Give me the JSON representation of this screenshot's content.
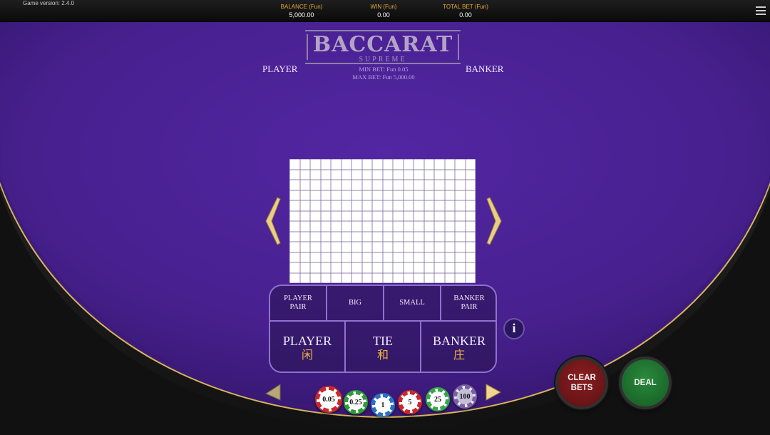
{
  "header": {
    "game_version": "Game version: 2.4.0",
    "balance_label": "BALANCE (Fun)",
    "balance_value": "5,000.00",
    "win_label": "WIN (Fun)",
    "win_value": "0.00",
    "total_bet_label": "TOTAL BET (Fun)",
    "total_bet_value": "0.00",
    "menu_icon": "hamburger-menu-icon"
  },
  "logo": {
    "title": "BACCARAT",
    "subtitle": "SUPREME"
  },
  "limits": {
    "min_bet": "MIN BET: Fun 0.05",
    "max_bet": "MAX BET: Fun 5,000.00"
  },
  "sides": {
    "player": "PLAYER",
    "banker": "BANKER"
  },
  "scoreboard": {
    "columns": 18,
    "rows": 12
  },
  "side_bets": [
    {
      "label": "PLAYER\nPAIR"
    },
    {
      "label": "BIG"
    },
    {
      "label": "SMALL"
    },
    {
      "label": "BANKER\nPAIR"
    }
  ],
  "main_bets": [
    {
      "label": "PLAYER",
      "chinese": "闲"
    },
    {
      "label": "TIE",
      "chinese": "和"
    },
    {
      "label": "BANKER",
      "chinese": "庄"
    }
  ],
  "info_label": "i",
  "chips": [
    {
      "value": "0.05",
      "color": "#c8282c"
    },
    {
      "value": "0.25",
      "color": "#2f9a3a"
    },
    {
      "value": "1",
      "color": "#2d6fc4"
    },
    {
      "value": "5",
      "color": "#c8282c"
    },
    {
      "value": "25",
      "color": "#3aa54a"
    },
    {
      "value": "100",
      "color": "#7d6aa8"
    }
  ],
  "buttons": {
    "clear_bets": "CLEAR\nBETS",
    "deal": "DEAL"
  },
  "colors": {
    "felt": "#4a1f96",
    "gold": "#d8b45a",
    "accent": "#e8a93a"
  }
}
